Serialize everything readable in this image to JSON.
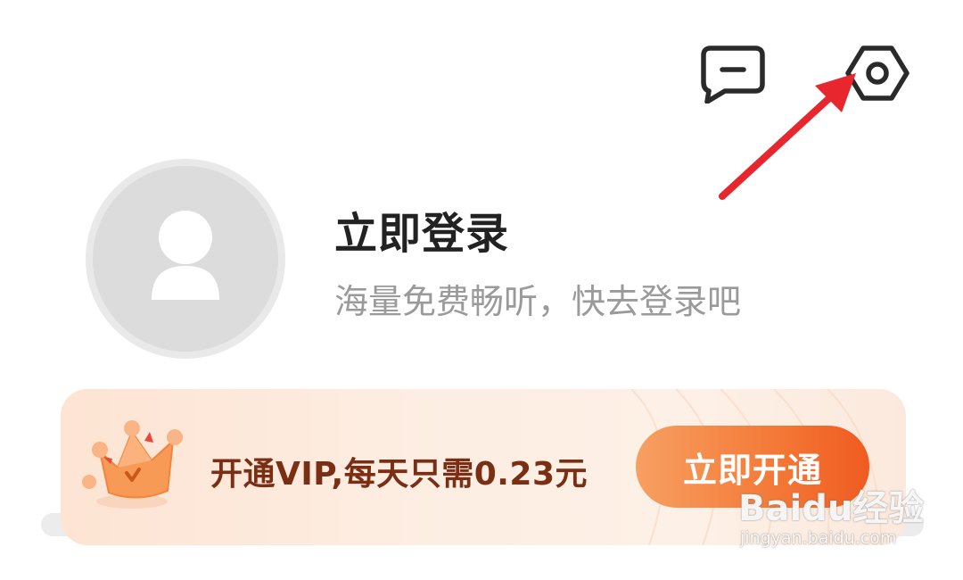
{
  "header": {
    "message_icon": "message-icon",
    "settings_icon": "settings-icon"
  },
  "annotation": {
    "arrow_color": "#e8262d",
    "arrow_icon": "red-arrow-icon"
  },
  "profile": {
    "avatar_icon": "default-user-icon",
    "title": "立即登录",
    "subtitle": "海量免费畅听，快去登录吧"
  },
  "vip_banner": {
    "crown_icon": "crown-icon",
    "text": "开通VIP,每天只需0.23元",
    "button_label": "立即开通"
  },
  "watermark": {
    "logo_text": "Baidu经验",
    "url": "jingyan.baidu.com"
  },
  "colors": {
    "title": "#222222",
    "subtitle": "#9a9a9a",
    "vip_text": "#7a2e14",
    "button_start": "#f7a062",
    "button_end": "#ef5b20"
  }
}
